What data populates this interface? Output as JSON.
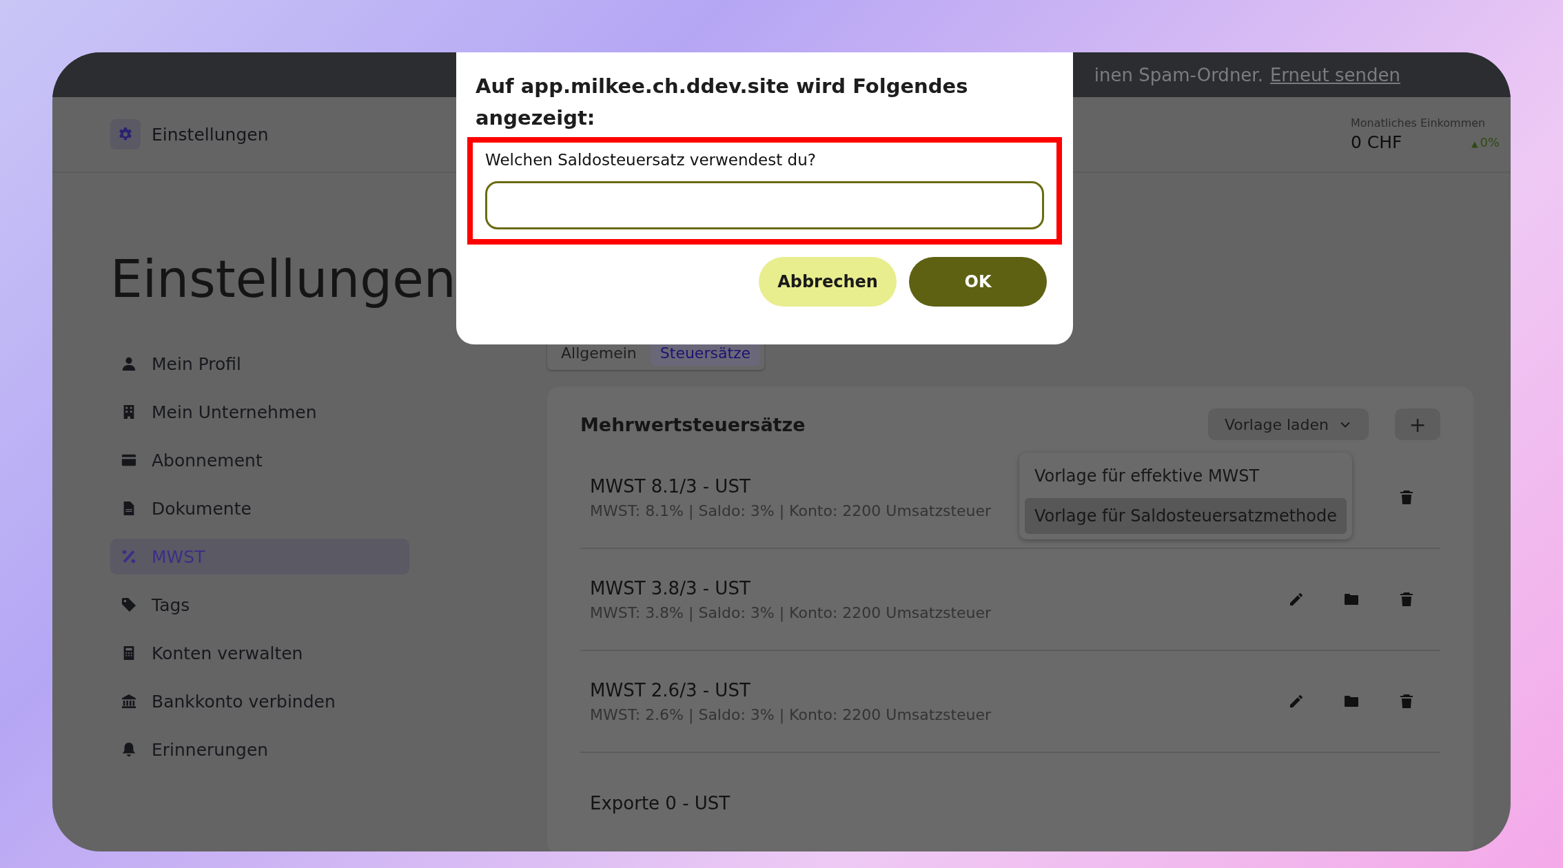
{
  "banner": {
    "text": "inen Spam-Ordner.",
    "link": "Erneut senden"
  },
  "header": {
    "title": "Einstellungen",
    "income_label": "Monatliches Einkommen",
    "income_value": "0 CHF",
    "change_arrow": "▲",
    "income_change": "0%"
  },
  "page_title": "Einstellungen",
  "sidebar": {
    "items": [
      {
        "label": "Mein Profil",
        "kind": "user",
        "selected": false
      },
      {
        "label": "Mein Unternehmen",
        "kind": "building",
        "selected": false
      },
      {
        "label": "Abonnement",
        "kind": "card",
        "selected": false
      },
      {
        "label": "Dokumente",
        "kind": "document",
        "selected": false
      },
      {
        "label": "MWST",
        "kind": "percent",
        "selected": true
      },
      {
        "label": "Tags",
        "kind": "tag",
        "selected": false
      },
      {
        "label": "Konten verwalten",
        "kind": "calculator",
        "selected": false
      },
      {
        "label": "Bankkonto verbinden",
        "kind": "bank",
        "selected": false
      },
      {
        "label": "Erinnerungen",
        "kind": "bell",
        "selected": false
      }
    ]
  },
  "tabs": [
    {
      "label": "Allgemein",
      "selected": false
    },
    {
      "label": "Steuersätze",
      "selected": true
    }
  ],
  "vat_card": {
    "title": "Mehrwertsteuersätze",
    "template_button": "Vorlage laden",
    "add_button": "+",
    "rows": [
      {
        "title": "MWST 8.1/3 - UST",
        "details": "MWST: 8.1% | Saldo: 3% | Konto: 2200 Umsatzsteuer",
        "kind": "partly_covered"
      },
      {
        "title": "MWST 3.8/3 - UST",
        "details": "MWST: 3.8% | Saldo: 3% | Konto: 2200 Umsatzsteuer",
        "kind": "full"
      },
      {
        "title": "MWST 2.6/3 - UST",
        "details": "MWST: 2.6% | Saldo: 3% | Konto: 2200 Umsatzsteuer",
        "kind": "full"
      },
      {
        "title": "Exporte 0 - UST"
      }
    ]
  },
  "template_menu": {
    "items": [
      {
        "label": "Vorlage für effektive MWST",
        "selected": false
      },
      {
        "label": "Vorlage für Saldosteuersatzmethode",
        "selected": true
      }
    ]
  },
  "dialog": {
    "title": "Auf app.milkee.ch.ddev.site wird Folgendes angezeigt:",
    "prompt": "Welchen Saldosteuersatz verwendest du?",
    "highlighted": true,
    "buttons": [
      {
        "label": "Abbrechen",
        "kind": "secondary"
      },
      {
        "label": "OK",
        "kind": "primary"
      }
    ]
  }
}
